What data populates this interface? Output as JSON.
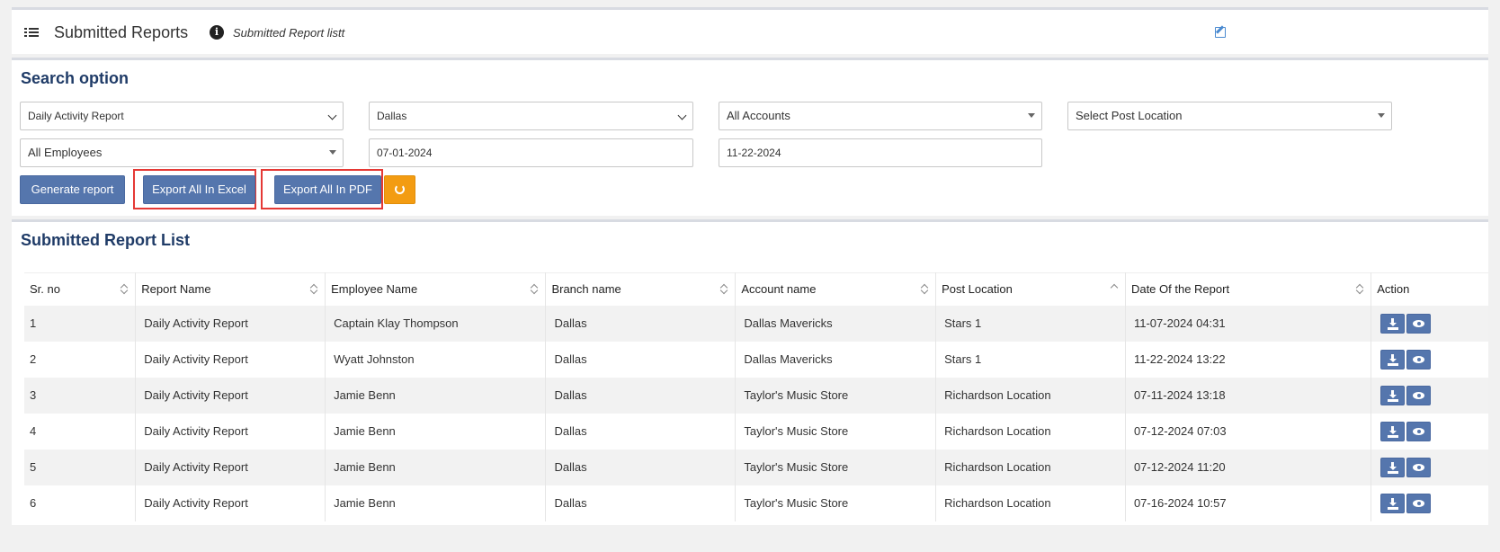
{
  "header": {
    "title": "Submitted Reports",
    "subtitle": "Submitted Report listt"
  },
  "search": {
    "title": "Search option",
    "report_type": "Daily Activity Report",
    "branch": "Dallas",
    "account": "All Accounts",
    "post_location": "Select Post Location",
    "employee": "All Employees",
    "start_date": "07-01-2024",
    "end_date": "11-22-2024",
    "generate_label": "Generate report",
    "excel_label": "Export All In Excel",
    "pdf_label": "Export All In PDF"
  },
  "list": {
    "title": "Submitted Report List",
    "columns": [
      "Sr. no",
      "Report Name",
      "Employee Name",
      "Branch name",
      "Account name",
      "Post Location",
      "Date Of the Report",
      "Action"
    ],
    "rows": [
      [
        "1",
        "Daily Activity Report",
        "Captain Klay Thompson",
        "Dallas",
        "Dallas Mavericks",
        "Stars 1",
        "11-07-2024 04:31"
      ],
      [
        "2",
        "Daily Activity Report",
        "Wyatt Johnston",
        "Dallas",
        "Dallas Mavericks",
        "Stars 1",
        "11-22-2024 13:22"
      ],
      [
        "3",
        "Daily Activity Report",
        "Jamie Benn",
        "Dallas",
        "Taylor's Music Store",
        "Richardson Location",
        "07-11-2024 13:18"
      ],
      [
        "4",
        "Daily Activity Report",
        "Jamie Benn",
        "Dallas",
        "Taylor's Music Store",
        "Richardson Location",
        "07-12-2024 07:03"
      ],
      [
        "5",
        "Daily Activity Report",
        "Jamie Benn",
        "Dallas",
        "Taylor's Music Store",
        "Richardson Location",
        "07-12-2024 11:20"
      ],
      [
        "6",
        "Daily Activity Report",
        "Jamie Benn",
        "Dallas",
        "Taylor's Music Store",
        "Richardson Location",
        "07-16-2024 10:57"
      ]
    ]
  }
}
